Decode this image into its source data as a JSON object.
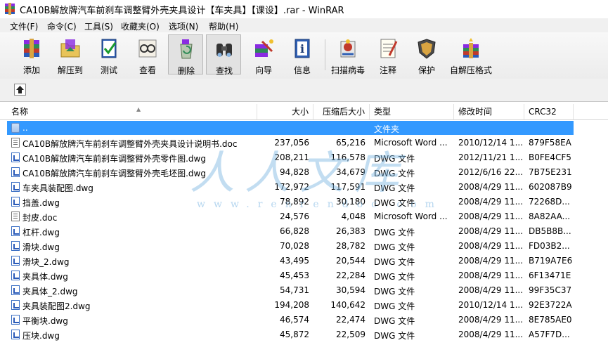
{
  "window": {
    "title": "CA10B解放牌汽车前刹车调整臂外壳夹具设计【车夹具】【课设】.rar - WinRAR"
  },
  "menu": [
    "文件(F)",
    "命令(C)",
    "工具(S)",
    "收藏夹(O)",
    "选项(N)",
    "帮助(H)"
  ],
  "toolbar": {
    "add": "添加",
    "extract": "解压到",
    "test": "测试",
    "view": "查看",
    "delete": "删除",
    "find": "查找",
    "wizard": "向导",
    "info": "信息",
    "scan": "扫描病毒",
    "comment": "注释",
    "protect": "保护",
    "sfx": "自解压格式"
  },
  "columns": {
    "name": "名称",
    "size": "大小",
    "packed": "压缩后大小",
    "type": "类型",
    "modified": "修改时间",
    "crc": "CRC32"
  },
  "files": [
    {
      "icon": "folder-up-icon",
      "name": "..",
      "size": "",
      "packed": "",
      "type": "文件夹",
      "modified": "",
      "crc": ""
    },
    {
      "icon": "doc-file-icon",
      "name": "CA10B解放牌汽车前刹车调整臂外壳夹具设计说明书.doc",
      "size": "237,056",
      "packed": "65,216",
      "type": "Microsoft Word ...",
      "modified": "2010/12/14 1...",
      "crc": "879F58EA"
    },
    {
      "icon": "dwg-file-icon",
      "name": "CA10B解放牌汽车前刹车调整臂外壳零件图.dwg",
      "size": "208,211",
      "packed": "116,578",
      "type": "DWG 文件",
      "modified": "2012/11/21 1...",
      "crc": "B0FE4CF5"
    },
    {
      "icon": "dwg-file-icon",
      "name": "CA10B解放牌汽车前刹车调整臂外壳毛坯图.dwg",
      "size": "94,828",
      "packed": "34,679",
      "type": "DWG 文件",
      "modified": "2012/6/16 22...",
      "crc": "7B75E231"
    },
    {
      "icon": "dwg-file-icon",
      "name": "车夹具装配图.dwg",
      "size": "172,972",
      "packed": "117,591",
      "type": "DWG 文件",
      "modified": "2008/4/29 11...",
      "crc": "602087B9"
    },
    {
      "icon": "dwg-file-icon",
      "name": "挡盖.dwg",
      "size": "78,892",
      "packed": "30,180",
      "type": "DWG 文件",
      "modified": "2008/4/29 11...",
      "crc": "72268D..."
    },
    {
      "icon": "doc-file-icon",
      "name": "封皮.doc",
      "size": "24,576",
      "packed": "4,048",
      "type": "Microsoft Word ...",
      "modified": "2008/4/29 11...",
      "crc": "8A82AA..."
    },
    {
      "icon": "dwg-file-icon",
      "name": "杠杆.dwg",
      "size": "66,828",
      "packed": "26,383",
      "type": "DWG 文件",
      "modified": "2008/4/29 11...",
      "crc": "DB5B8B..."
    },
    {
      "icon": "dwg-file-icon",
      "name": "滑块.dwg",
      "size": "70,028",
      "packed": "28,782",
      "type": "DWG 文件",
      "modified": "2008/4/29 11...",
      "crc": "FD03B2..."
    },
    {
      "icon": "dwg-file-icon",
      "name": "滑块_2.dwg",
      "size": "43,495",
      "packed": "20,544",
      "type": "DWG 文件",
      "modified": "2008/4/29 11...",
      "crc": "B719A7E6"
    },
    {
      "icon": "dwg-file-icon",
      "name": "夹具体.dwg",
      "size": "45,453",
      "packed": "22,284",
      "type": "DWG 文件",
      "modified": "2008/4/29 11...",
      "crc": "6F13471E"
    },
    {
      "icon": "dwg-file-icon",
      "name": "夹具体_2.dwg",
      "size": "54,731",
      "packed": "30,594",
      "type": "DWG 文件",
      "modified": "2008/4/29 11...",
      "crc": "99F35C37"
    },
    {
      "icon": "dwg-file-icon",
      "name": "夹具装配图2.dwg",
      "size": "194,208",
      "packed": "140,642",
      "type": "DWG 文件",
      "modified": "2010/12/14 1...",
      "crc": "92E3722A"
    },
    {
      "icon": "dwg-file-icon",
      "name": "平衡块.dwg",
      "size": "46,574",
      "packed": "22,474",
      "type": "DWG 文件",
      "modified": "2008/4/29 11...",
      "crc": "8E785AE0"
    },
    {
      "icon": "dwg-file-icon",
      "name": "压块.dwg",
      "size": "45,872",
      "packed": "22,509",
      "type": "DWG 文件",
      "modified": "2008/4/29 11...",
      "crc": "A57F7D..."
    }
  ],
  "watermark": {
    "text": "人人文库",
    "url": "www.renrendoc.com"
  },
  "colors": {
    "selection": "#3399ff",
    "menubar": "#f0f0f0",
    "watermark": "#78b4e1"
  }
}
